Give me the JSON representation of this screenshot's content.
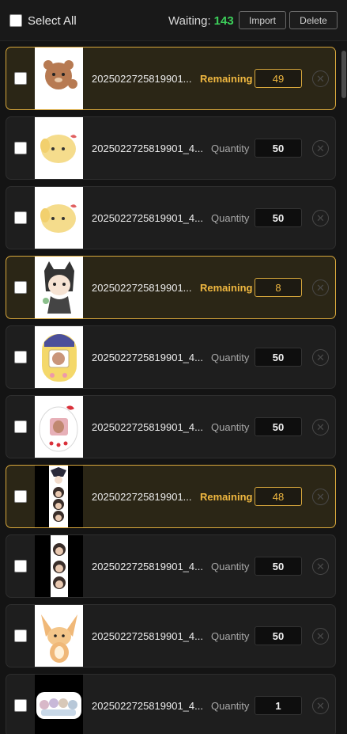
{
  "header": {
    "select_all_label": "Select All",
    "waiting_label": "Waiting:",
    "waiting_count": "143",
    "import_label": "Import",
    "delete_label": "Delete"
  },
  "items": [
    {
      "file": "2025022725819901...",
      "label": "Remaining",
      "qty": "49",
      "highlight": true,
      "art": "bear"
    },
    {
      "file": "2025022725819901_4...",
      "label": "Quantity",
      "qty": "50",
      "highlight": false,
      "art": "puppy"
    },
    {
      "file": "2025022725819901_4...",
      "label": "Quantity",
      "qty": "50",
      "highlight": false,
      "art": "puppy"
    },
    {
      "file": "2025022725819901...",
      "label": "Remaining",
      "qty": "8",
      "highlight": true,
      "art": "cat-boy"
    },
    {
      "file": "2025022725819901_4...",
      "label": "Quantity",
      "qty": "50",
      "highlight": false,
      "art": "tamagotchi"
    },
    {
      "file": "2025022725819901_4...",
      "label": "Quantity",
      "qty": "50",
      "highlight": false,
      "art": "kitty-device"
    },
    {
      "file": "2025022725819901...",
      "label": "Remaining",
      "qty": "48",
      "highlight": true,
      "art": "portrait-strip"
    },
    {
      "file": "2025022725819901_4...",
      "label": "Quantity",
      "qty": "50",
      "highlight": false,
      "art": "face-strip"
    },
    {
      "file": "2025022725819901_4...",
      "label": "Quantity",
      "qty": "50",
      "highlight": false,
      "art": "fox"
    },
    {
      "file": "2025022725819901_4...",
      "label": "Quantity",
      "qty": "1",
      "highlight": false,
      "art": "group"
    }
  ],
  "colors": {
    "highlight_border": "#d7a73c",
    "remaining_text": "#f0b840",
    "waiting_count": "#3ccf5a"
  }
}
